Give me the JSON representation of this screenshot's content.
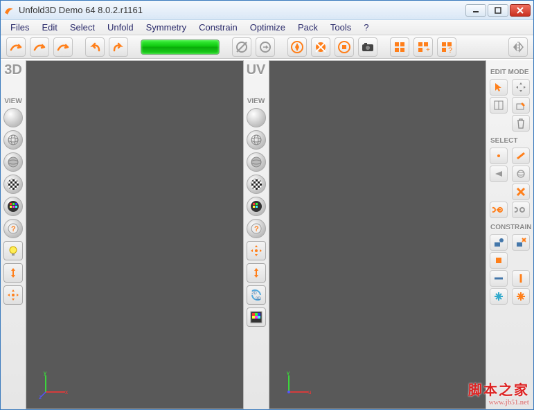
{
  "window": {
    "title": "Unfold3D Demo 64 8.0.2.r1161"
  },
  "menu": {
    "items": [
      "Files",
      "Edit",
      "Select",
      "Unfold",
      "Symmetry",
      "Constrain",
      "Optimize",
      "Pack",
      "Tools",
      "?"
    ]
  },
  "left3d": {
    "title": "3D",
    "view": "VIEW"
  },
  "leftuv": {
    "title": "UV",
    "view": "VIEW"
  },
  "right": {
    "editmode": "EDIT MODE",
    "select": "SELECT",
    "constrain": "CONSTRAIN"
  },
  "watermark": {
    "text": "脚本之家",
    "url": "www.jb51.net"
  }
}
